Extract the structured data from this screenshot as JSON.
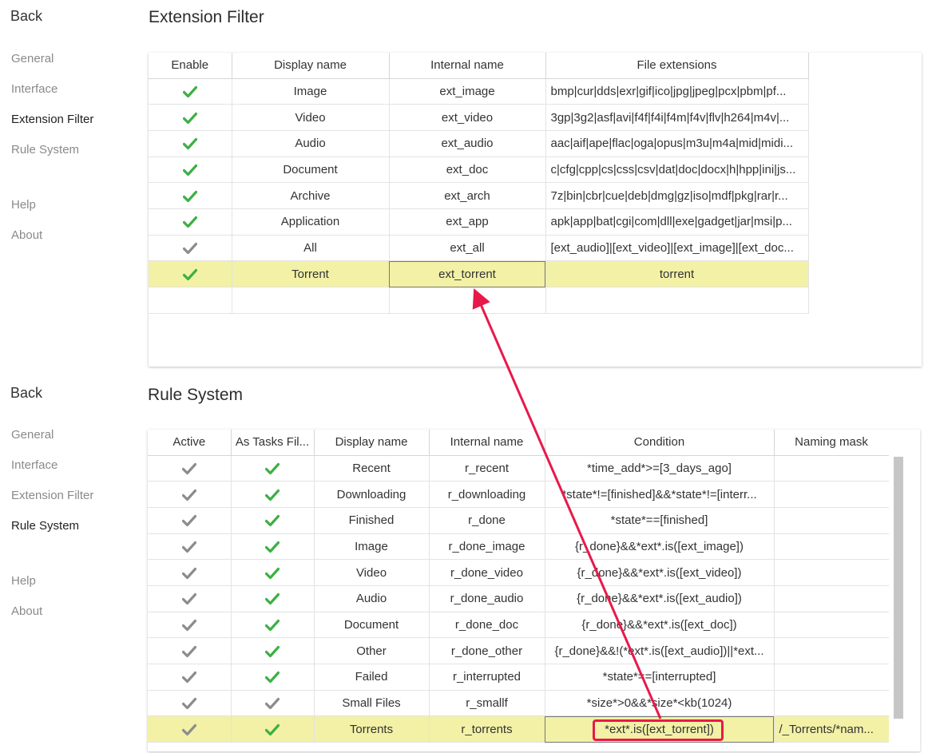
{
  "ext_panel": {
    "back_label": "Back",
    "nav": [
      "General",
      "Interface",
      "Extension Filter",
      "Rule System"
    ],
    "nav2": [
      "Help",
      "About"
    ],
    "active_nav": "Extension Filter",
    "title": "Extension Filter",
    "columns": [
      "Enable",
      "Display name",
      "Internal name",
      "File extensions"
    ],
    "rows": [
      {
        "enabled": "green",
        "display": "Image",
        "internal": "ext_image",
        "extensions": "bmp|cur|dds|exr|gif|ico|jpg|jpeg|pcx|pbm|pf..."
      },
      {
        "enabled": "green",
        "display": "Video",
        "internal": "ext_video",
        "extensions": "3gp|3g2|asf|avi|f4f|f4i|f4m|f4v|flv|h264|m4v|..."
      },
      {
        "enabled": "green",
        "display": "Audio",
        "internal": "ext_audio",
        "extensions": "aac|aif|ape|flac|oga|opus|m3u|m4a|mid|midi..."
      },
      {
        "enabled": "green",
        "display": "Document",
        "internal": "ext_doc",
        "extensions": "c|cfg|cpp|cs|css|csv|dat|doc|docx|h|hpp|ini|js..."
      },
      {
        "enabled": "green",
        "display": "Archive",
        "internal": "ext_arch",
        "extensions": "7z|bin|cbr|cue|deb|dmg|gz|iso|mdf|pkg|rar|r..."
      },
      {
        "enabled": "green",
        "display": "Application",
        "internal": "ext_app",
        "extensions": "apk|app|bat|cgi|com|dll|exe|gadget|jar|msi|p..."
      },
      {
        "enabled": "gray",
        "display": "All",
        "internal": "ext_all",
        "extensions": "[ext_audio]|[ext_video]|[ext_image]|[ext_doc..."
      },
      {
        "enabled": "green",
        "display": "Torrent",
        "internal": "ext_torrent",
        "extensions": "torrent",
        "highlight": true
      }
    ]
  },
  "rule_panel": {
    "back_label": "Back",
    "nav": [
      "General",
      "Interface",
      "Extension Filter",
      "Rule System"
    ],
    "nav2": [
      "Help",
      "About"
    ],
    "active_nav": "Rule System",
    "title": "Rule System",
    "columns": [
      "Active",
      "As Tasks Fil...",
      "Display name",
      "Internal name",
      "Condition",
      "Naming mask"
    ],
    "rows": [
      {
        "active": "gray",
        "as_tasks": "green",
        "display": "Recent",
        "internal": "r_recent",
        "condition": "*time_add*>=[3_days_ago]",
        "mask": ""
      },
      {
        "active": "gray",
        "as_tasks": "green",
        "display": "Downloading",
        "internal": "r_downloading",
        "condition": "*state*!=[finished]&&*state*!=[interr...",
        "mask": ""
      },
      {
        "active": "gray",
        "as_tasks": "green",
        "display": "Finished",
        "internal": "r_done",
        "condition": "*state*==[finished]",
        "mask": ""
      },
      {
        "active": "gray",
        "as_tasks": "green",
        "display": "Image",
        "internal": "r_done_image",
        "condition": "{r_done}&&*ext*.is([ext_image])",
        "mask": ""
      },
      {
        "active": "gray",
        "as_tasks": "green",
        "display": "Video",
        "internal": "r_done_video",
        "condition": "{r_done}&&*ext*.is([ext_video])",
        "mask": ""
      },
      {
        "active": "gray",
        "as_tasks": "green",
        "display": "Audio",
        "internal": "r_done_audio",
        "condition": "{r_done}&&*ext*.is([ext_audio])",
        "mask": ""
      },
      {
        "active": "gray",
        "as_tasks": "green",
        "display": "Document",
        "internal": "r_done_doc",
        "condition": "{r_done}&&*ext*.is([ext_doc])",
        "mask": ""
      },
      {
        "active": "gray",
        "as_tasks": "green",
        "display": "Other",
        "internal": "r_done_other",
        "condition": "{r_done}&&!(*ext*.is([ext_audio])||*ext...",
        "mask": ""
      },
      {
        "active": "gray",
        "as_tasks": "green",
        "display": "Failed",
        "internal": "r_interrupted",
        "condition": "*state*==[interrupted]",
        "mask": ""
      },
      {
        "active": "gray",
        "as_tasks": "gray",
        "display": "Small Files",
        "internal": "r_smallf",
        "condition": "*size*>0&&*size*<kb(1024)",
        "mask": ""
      },
      {
        "active": "gray",
        "as_tasks": "green",
        "display": "Torrents",
        "internal": "r_torrents",
        "condition": "*ext*.is([ext_torrent])",
        "mask": "/_Torrents/*nam...",
        "highlight": true
      }
    ]
  },
  "colors": {
    "check_green": "#3cb043",
    "check_gray": "#8c8c8c",
    "highlight_row": "#f2f1a6",
    "annotation_red": "#e8194a"
  }
}
